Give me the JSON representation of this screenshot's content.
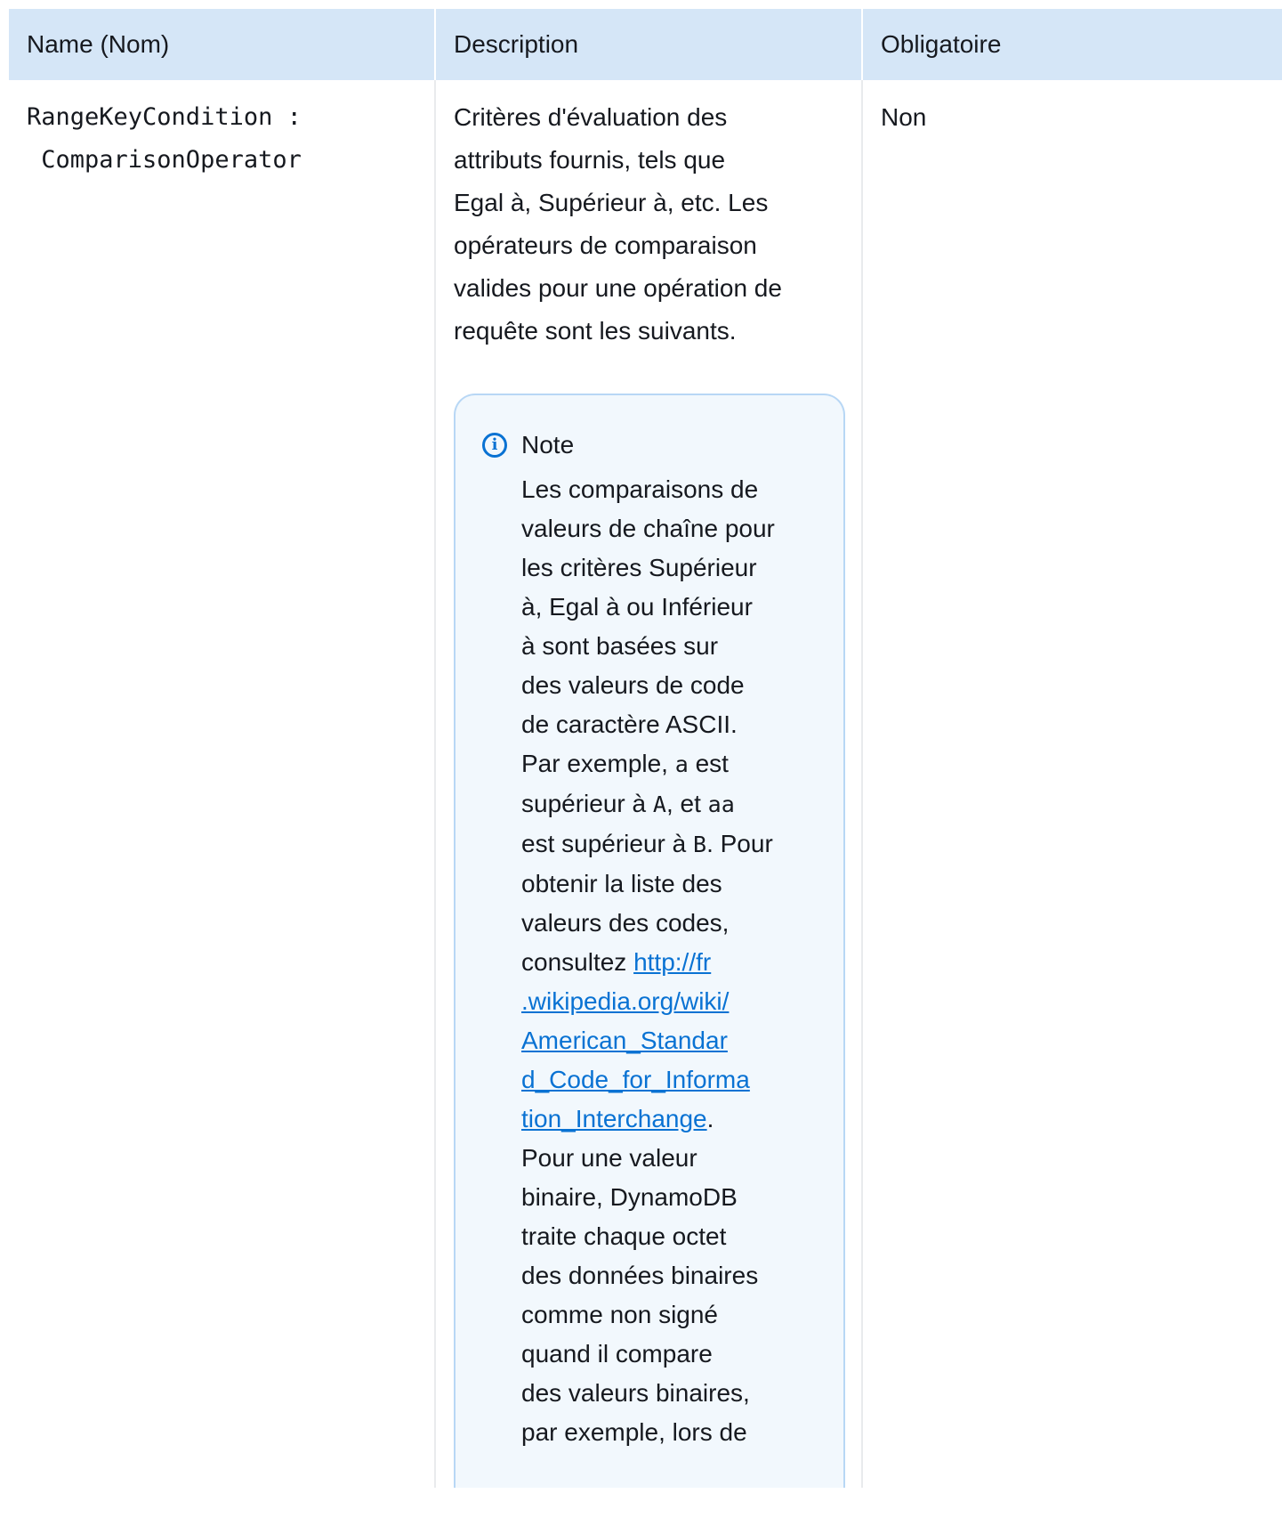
{
  "table": {
    "headers": [
      "Name (Nom)",
      "Description",
      "Obligatoire"
    ],
    "row": {
      "name_lines": [
        "RangeKeyCondition :",
        " ComparisonOperator"
      ],
      "description_lines": [
        "Critères d'évaluation des",
        "attributs fournis, tels que",
        "Egal à, Supérieur à, etc. Les",
        "opérateurs de comparaison",
        "valides pour une opération de",
        "requête sont les suivants."
      ],
      "required": "Non"
    }
  },
  "note": {
    "title": "Note",
    "icon": "info-icon",
    "lines_before_link": [
      "Les comparaisons de",
      "valeurs de chaîne pour",
      "les critères Supérieur",
      "à, Egal à ou Inférieur",
      "à sont basées sur",
      "des valeurs de code",
      "de caractère ASCII."
    ],
    "example": {
      "l1_pre": "Par exemple, ",
      "l1_code": "a",
      "l1_post": " est",
      "l2_pre": "supérieur à ",
      "l2_code1": "A",
      "l2_mid": ", et ",
      "l2_code2": "aa",
      "l3_pre": "est supérieur à ",
      "l3_code": "B",
      "l3_post": ". Pour"
    },
    "lines_mid": [
      "obtenir la liste des",
      "valeurs des codes,"
    ],
    "consult_prefix": "consultez ",
    "link_lines": [
      "http://fr",
      ".wikipedia.org/wiki/",
      "American_Standar",
      "d_Code_for_Informa",
      "tion_Interchange"
    ],
    "link_suffix": ".",
    "lines_after_link": [
      "Pour une valeur",
      "binaire, DynamoDB",
      "traite chaque octet",
      "des données binaires",
      "comme non signé",
      "quand il compare",
      "des valeurs binaires,",
      "par exemple, lors de"
    ]
  }
}
